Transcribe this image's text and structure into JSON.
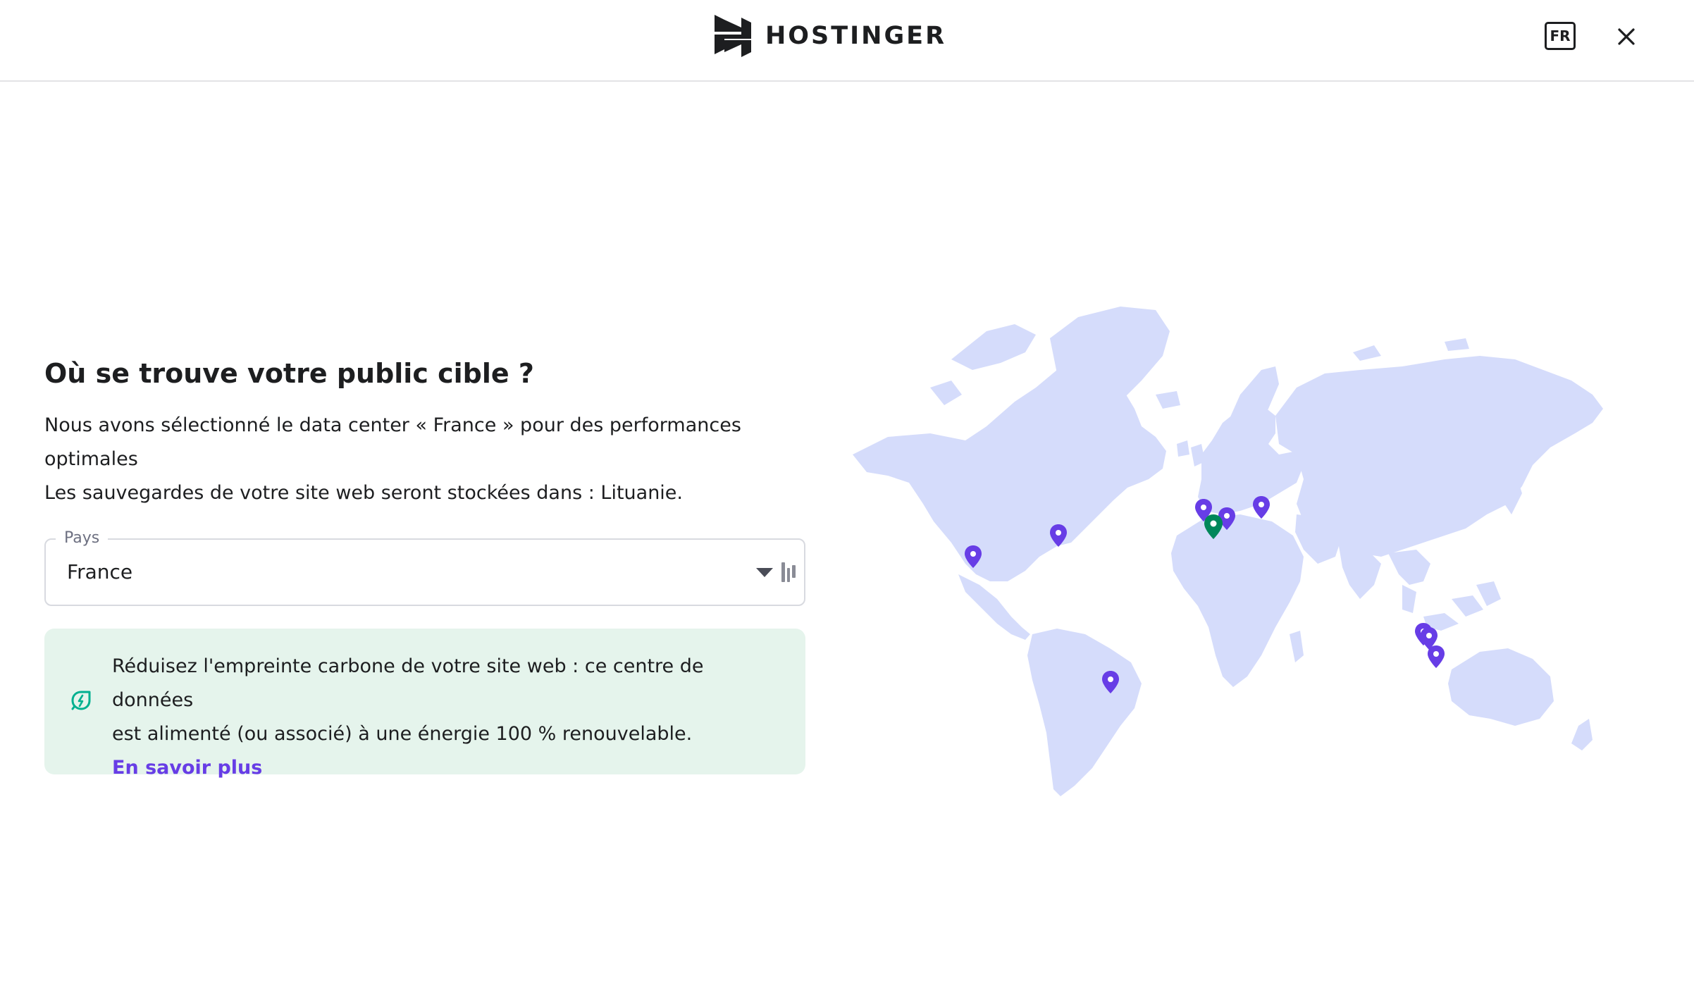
{
  "header": {
    "brand": "HOSTINGER",
    "language": "FR"
  },
  "main": {
    "title": "Où se trouve votre public cible ?",
    "description_line1": "Nous avons sélectionné le data center « France » pour des performances optimales",
    "description_line2": "Les sauvegardes de votre site web seront stockées dans : Lituanie.",
    "country_field": {
      "label": "Pays",
      "value": "France"
    },
    "eco_notice": {
      "text_line1": "Réduisez l'empreinte carbone de votre site web : ce centre de données",
      "text_line2": "est alimenté (ou associé) à une énergie 100 % renouvelable.",
      "link": "En savoir plus"
    }
  },
  "map": {
    "land_color": "#d5dcfb",
    "pin_color": "#673de6",
    "selected_pin_color": "#00875a"
  },
  "colors": {
    "accent": "#673de6",
    "eco_bg": "#e5f4ec",
    "eco_icon": "#00b090"
  }
}
